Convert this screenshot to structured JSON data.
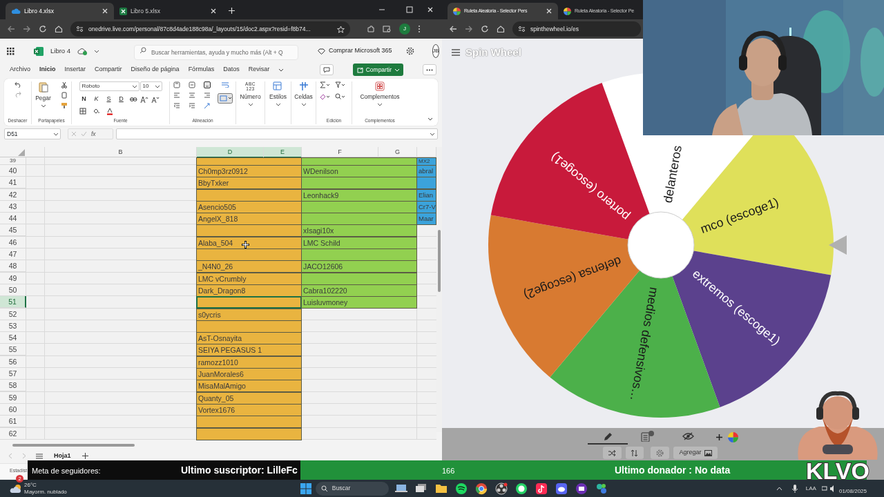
{
  "left_browser": {
    "tabs": [
      {
        "title": "Libro 4.xlsx",
        "selected": true,
        "kind": "onedrive"
      },
      {
        "title": "Libro 5.xlsx",
        "selected": false,
        "kind": "excel"
      }
    ],
    "url": "onedrive.live.com/personal/87c8d4ade188c98a/_layouts/15/doc2.aspx?resid=f8b74...",
    "profile": "J"
  },
  "excel": {
    "file_name": "Libro 4",
    "search": {
      "placeholder": "Buscar herramientas, ayuda y mucho más (Alt + Q"
    },
    "buy_button": "Comprar Microsoft 365",
    "avatar": "JB",
    "menu": [
      {
        "label": "Archivo",
        "selected": false
      },
      {
        "label": "Inicio",
        "selected": true
      },
      {
        "label": "Insertar",
        "selected": false
      },
      {
        "label": "Compartir",
        "selected": false
      },
      {
        "label": "Diseño de página",
        "selected": false
      },
      {
        "label": "Fórmulas",
        "selected": false
      },
      {
        "label": "Datos",
        "selected": false
      },
      {
        "label": "Revisar",
        "selected": false
      }
    ],
    "share_button": "Compartir",
    "ribbon": {
      "undo_label": "Deshacer",
      "paste": "Pegar",
      "clipboard_label": "Portapapeles",
      "font_name": "Roboto",
      "font_size": "10",
      "style_buttons": [
        "N",
        "K",
        "S",
        "D"
      ],
      "font_label": "Fuente",
      "alignment_label": "Alineación",
      "number_icon": [
        "ABC",
        "123"
      ],
      "big_buttons": [
        {
          "label": "Número",
          "kind": "number"
        },
        {
          "label": "Estilos",
          "kind": "styles"
        },
        {
          "label": "Celdas",
          "kind": "cells"
        }
      ],
      "editing_label": "Edición",
      "addins_button": "Complementos",
      "addins_label": "Complementos"
    },
    "name_box": "D51",
    "function_label": "fx",
    "columns": [
      {
        "label": "B",
        "selected": false
      },
      {
        "label": "D",
        "selected": true
      },
      {
        "label": "E",
        "selected": true
      },
      {
        "label": "F",
        "selected": false
      },
      {
        "label": "G",
        "selected": false
      }
    ],
    "rows": [
      {
        "number": "39",
        "selected": false,
        "d": {
          "color": "#e9b440"
        },
        "f": {
          "color": "#92d050"
        },
        "h": {
          "text": "MX2",
          "color": "#3ba3db"
        }
      },
      {
        "number": "40",
        "selected": false,
        "d": {
          "text": "Ch0mp3rz0912",
          "color": "#e9b440"
        },
        "f": {
          "text": "WDenilson",
          "color": "#92d050"
        },
        "h": {
          "text": "abral",
          "color": "#3ba3db"
        }
      },
      {
        "number": "41",
        "selected": false,
        "d": {
          "text": "BbyTxker",
          "color": "#e9b440"
        },
        "f": {
          "color": "#92d050"
        },
        "h": {
          "color": "#3ba3db"
        }
      },
      {
        "number": "42",
        "selected": false,
        "d": {
          "color": "#e9b440"
        },
        "f": {
          "text": "Leonhack9",
          "color": "#92d050"
        },
        "h": {
          "text": "Elian",
          "color": "#3ba3db"
        }
      },
      {
        "number": "43",
        "selected": false,
        "d": {
          "text": "Asencio505",
          "color": "#e9b440"
        },
        "f": {
          "color": "#92d050"
        },
        "h": {
          "text": "Cr7-V",
          "color": "#3ba3db"
        }
      },
      {
        "number": "44",
        "selected": false,
        "d": {
          "text": "AngelX_818",
          "color": "#e9b440"
        },
        "f": {
          "color": "#92d050"
        },
        "h": {
          "text": "Maar",
          "color": "#3ba3db"
        }
      },
      {
        "number": "45",
        "selected": false,
        "d": {
          "color": "#e9b440"
        },
        "f": {
          "text": "xIsagi10x",
          "color": "#92d050"
        }
      },
      {
        "number": "46",
        "selected": false,
        "d": {
          "text": "Alaba_504",
          "color": "#e9b440"
        },
        "f": {
          "text": "LMC Schild",
          "color": "#92d050"
        }
      },
      {
        "number": "47",
        "selected": false,
        "d": {
          "color": "#e9b440"
        },
        "f": {
          "color": "#92d050"
        }
      },
      {
        "number": "48",
        "selected": false,
        "d": {
          "text": "_N4N0_26",
          "color": "#e9b440"
        },
        "f": {
          "text": "JACO12606",
          "color": "#92d050"
        }
      },
      {
        "number": "49",
        "selected": false,
        "d": {
          "text": "LMC vCrumbly",
          "color": "#e9b440"
        },
        "f": {
          "color": "#92d050"
        }
      },
      {
        "number": "50",
        "selected": false,
        "d": {
          "text": "Dark_Dragon8",
          "color": "#e9b440"
        },
        "f": {
          "text": "Cabra102220",
          "color": "#92d050"
        }
      },
      {
        "number": "51",
        "selected": true,
        "d": {
          "color": "#e9b440"
        },
        "f": {
          "text": "Luisluvmoney",
          "color": "#92d050"
        }
      },
      {
        "number": "52",
        "selected": false,
        "d": {
          "text": "s0ycris",
          "color": "#e9b440"
        }
      },
      {
        "number": "53",
        "selected": false,
        "d": {
          "color": "#e9b440"
        }
      },
      {
        "number": "54",
        "selected": false,
        "d": {
          "text": "AsT-Osnayita",
          "color": "#e9b440"
        }
      },
      {
        "number": "55",
        "selected": false,
        "d": {
          "text": "SEIYA PEGASUS 1",
          "color": "#e9b440"
        }
      },
      {
        "number": "56",
        "selected": false,
        "d": {
          "text": "ramozz1010",
          "color": "#e9b440"
        }
      },
      {
        "number": "57",
        "selected": false,
        "d": {
          "text": "JuanMorales6",
          "color": "#e9b440"
        }
      },
      {
        "number": "58",
        "selected": false,
        "d": {
          "text": "MisaMalAmigo",
          "color": "#e9b440"
        }
      },
      {
        "number": "59",
        "selected": false,
        "d": {
          "text": "Quanty_05",
          "color": "#e9b440"
        }
      },
      {
        "number": "60",
        "selected": false,
        "d": {
          "text": "Vortex1676",
          "color": "#e9b440"
        }
      },
      {
        "number": "61",
        "selected": false,
        "d": {
          "color": "#e9b440"
        }
      },
      {
        "number": "62",
        "selected": false,
        "d": {
          "color": "#e9b440"
        }
      }
    ],
    "sheet_tabs": [
      {
        "label": "Hoja1",
        "selected": true
      }
    ],
    "status": "Estadíst"
  },
  "right_browser": {
    "tabs": [
      {
        "title": "Ruleta Aleatoria - Selector Pers",
        "selected": true
      },
      {
        "title": "Ruleta Aleatoria - Selector Pe",
        "selected": false
      }
    ],
    "url": "spinthewheel.io/es"
  },
  "wheel_page": {
    "logo": "Spin Wheel",
    "segments": [
      {
        "label": "delanteros",
        "color": "#ffffff"
      },
      {
        "label": "mco (escoge1)",
        "color": "#dfe05a"
      },
      {
        "label": "extremos (escoge1)",
        "color": "#5b418d"
      },
      {
        "label": "medios defensivos…",
        "color": "#4cb04a"
      },
      {
        "label": "defensa (escoge2)",
        "color": "#d87a31"
      },
      {
        "label": "portero (escoge1)",
        "color": "#c81a3b"
      }
    ],
    "tabs": [
      {
        "kind": "edit",
        "selected": true
      },
      {
        "kind": "results",
        "selected": false
      },
      {
        "kind": "hide",
        "selected": false
      }
    ],
    "add_button": "Agregar"
  },
  "overlay": {
    "follower_goal": "Meta de seguidores:",
    "last_subscriber": "Ultimo suscriptor: LilleFc",
    "count": "166",
    "last_donor": "Ultimo donador : No data",
    "logo": "KLVO"
  },
  "taskbar": {
    "weather_badge": "2",
    "temperature": "26°C",
    "weather": "Mayorm. nublado",
    "search": "Buscar",
    "language": "LAA",
    "date": "01/08/2025"
  }
}
